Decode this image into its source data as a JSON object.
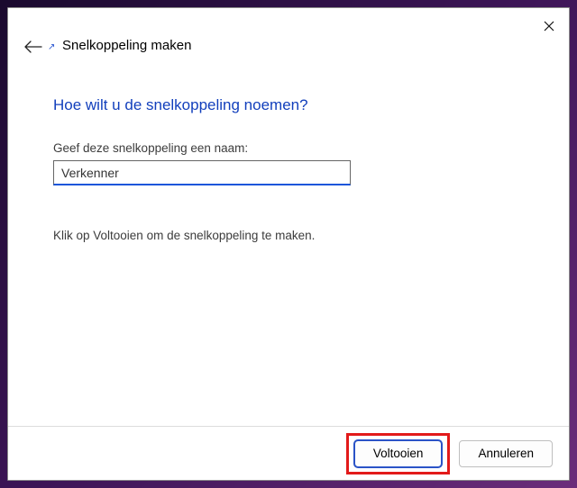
{
  "window": {
    "title": "Snelkoppeling maken"
  },
  "content": {
    "heading": "Hoe wilt u de snelkoppeling noemen?",
    "nameFieldLabel": "Geef deze snelkoppeling een naam:",
    "nameFieldValue": "Verkenner",
    "instruction": "Klik op Voltooien om de snelkoppeling te maken."
  },
  "buttons": {
    "finish": "Voltooien",
    "cancel": "Annuleren"
  }
}
